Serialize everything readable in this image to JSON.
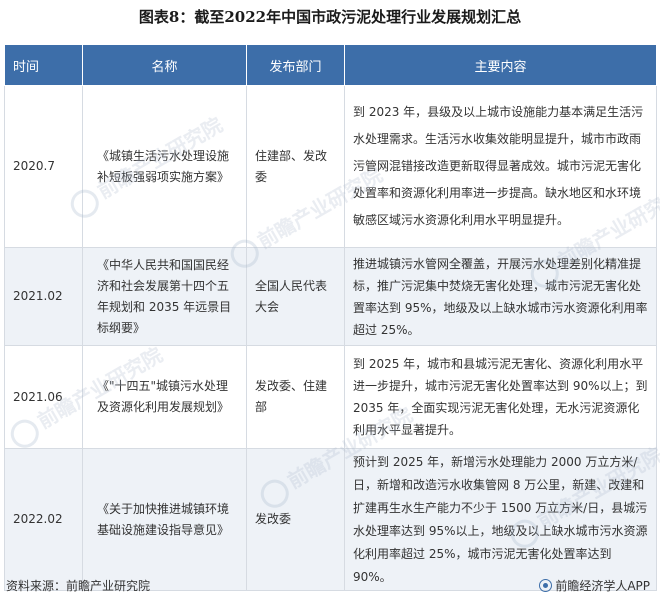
{
  "title": "图表8：截至2022年中国市政污泥处理行业发展规划汇总",
  "table": {
    "headers": [
      "时间",
      "名称",
      "发布部门",
      "主要内容"
    ],
    "rows": [
      {
        "time": "2020.7",
        "name": "《城镇生活污水处理设施补短板强弱项实施方案》",
        "dept": "住建部、发改委",
        "content": "到 2023 年，县级及以上城市设施能力基本满足生活污水处理需求。生活污水收集效能明显提升，城市市政雨污管网混错接改造更新取得显著成效。城市污泥无害化处置率和资源化利用率进一步提高。缺水地区和水环境敏感区域污水资源化利用水平明显提升。"
      },
      {
        "time": "2021.02",
        "name": "《中华人民共和国国民经济和社会发展第十四个五年规划和 2035 年远景目标纲要》",
        "dept": "全国人民代表大会",
        "content": "推进城镇污水管网全覆盖，开展污水处理差别化精准提标，推广污泥集中焚烧无害化处理，城市污泥无害化处置率达到 95%，地级及以上缺水城市污水资源化利用率超过 25%。"
      },
      {
        "time": "2021.06",
        "name": "《\"十四五\"城镇污水处理及资源化利用发展规划》",
        "dept": "发改委、住建部",
        "content": "到 2025 年，城市和县城污泥无害化、资源化利用水平进一步提升，城市污泥无害化处置率达到 90%以上；到 2035 年，全面实现污泥无害化处理，无水污泥资源化利用水平显著提升。"
      },
      {
        "time": "2022.02",
        "name": "《关于加快推进城镇环境基础设施建设指导意见》",
        "dept": "发改委",
        "content": "预计到 2025 年，新增污水处理能力 2000 万立方米/日，新增和改造污水收集管网 8 万公里，新建、改建和扩建再生水生产能力不少于 1500 万立方米/日，县城污水处理率达到 95%以上，地级及以上缺水城市污水资源化利用率超过 25%，城市污泥无害化处置率达到 90%。"
      }
    ]
  },
  "watermark": {
    "text_cn": "前瞻产业研究院",
    "icon": "qianzhan-logo-icon"
  },
  "footer": {
    "source": "资料来源：前瞻产业研究院",
    "brand": "前瞻经济学人APP",
    "brand_icon": "qianzhan-app-icon"
  },
  "colors": {
    "header_bg": "#3d6ea9",
    "alt_row_bg": "#eef2f7",
    "border": "#d6dbe2"
  }
}
